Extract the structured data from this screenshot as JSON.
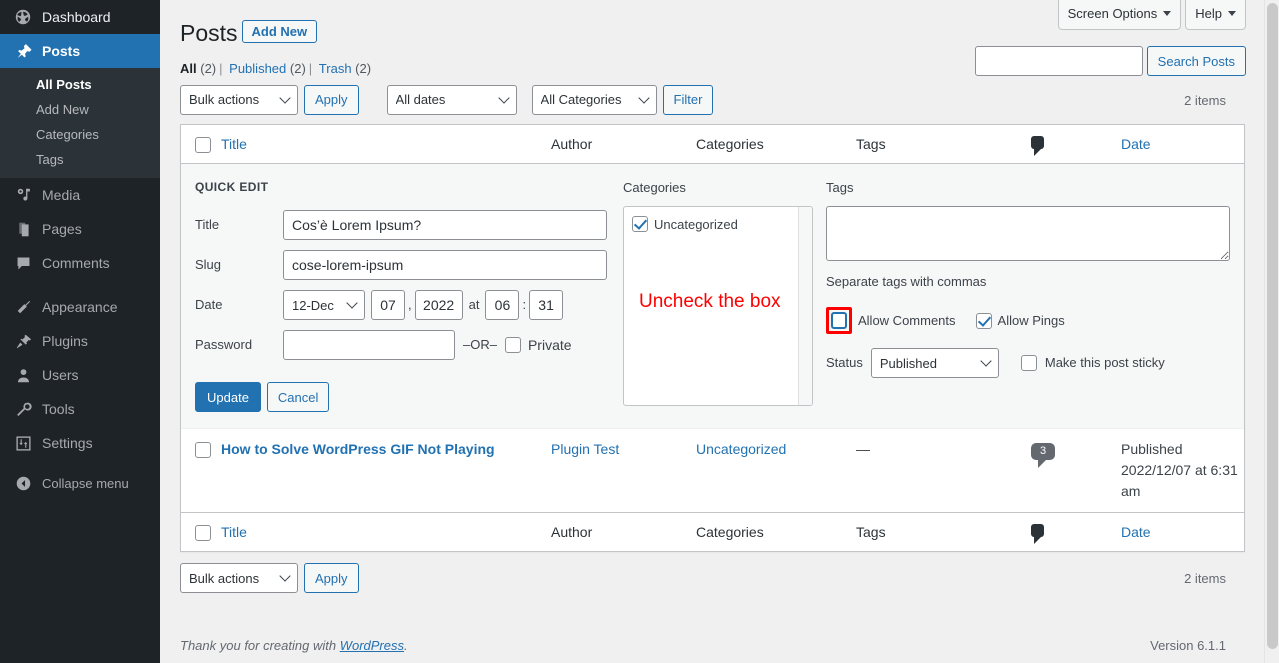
{
  "sidebar": {
    "items": [
      {
        "label": "Dashboard",
        "icon": "dashboard-icon",
        "current": false,
        "dim": false
      },
      {
        "label": "Posts",
        "icon": "pin-icon",
        "current": true,
        "dim": false
      },
      {
        "label": "Media",
        "icon": "media-icon",
        "current": false,
        "dim": true
      },
      {
        "label": "Pages",
        "icon": "pages-icon",
        "current": false,
        "dim": true
      },
      {
        "label": "Comments",
        "icon": "comment-icon",
        "current": false,
        "dim": true
      },
      {
        "label": "Appearance",
        "icon": "appearance-icon",
        "current": false,
        "dim": true
      },
      {
        "label": "Plugins",
        "icon": "plugins-icon",
        "current": false,
        "dim": true
      },
      {
        "label": "Users",
        "icon": "users-icon",
        "current": false,
        "dim": true
      },
      {
        "label": "Tools",
        "icon": "tools-icon",
        "current": false,
        "dim": true
      },
      {
        "label": "Settings",
        "icon": "settings-icon",
        "current": false,
        "dim": true
      }
    ],
    "submenu": [
      {
        "label": "All Posts",
        "current": true
      },
      {
        "label": "Add New",
        "current": false
      },
      {
        "label": "Categories",
        "current": false
      },
      {
        "label": "Tags",
        "current": false
      }
    ],
    "collapse_label": "Collapse menu",
    "collapse_icon": "collapse-arrow-icon",
    "accent_color": "#2271b1",
    "bg_color": "#1d2327"
  },
  "screen_meta": {
    "screen_options_label": "Screen Options",
    "help_label": "Help"
  },
  "header": {
    "title": "Posts",
    "add_new_label": "Add New"
  },
  "search": {
    "value": "",
    "placeholder": "",
    "button_label": "Search Posts"
  },
  "views": [
    {
      "label": "All",
      "count": "(2)",
      "current": true
    },
    {
      "label": "Published",
      "count": "(2)",
      "current": false
    },
    {
      "label": "Trash",
      "count": "(2)",
      "current": false
    }
  ],
  "tablenav_top": {
    "bulk_actions_value": "Bulk actions",
    "apply_label": "Apply",
    "all_dates_value": "All dates",
    "all_categories_value": "All Categories",
    "filter_label": "Filter",
    "displaying_num": "2 items"
  },
  "tablenav_bottom": {
    "bulk_actions_value": "Bulk actions",
    "apply_label": "Apply",
    "displaying_num": "2 items"
  },
  "table": {
    "columns": {
      "title": "Title",
      "author": "Author",
      "categories": "Categories",
      "tags": "Tags",
      "comments_icon": "comment-icon",
      "date": "Date"
    },
    "rows": [
      {
        "title": "How to Solve WordPress GIF Not Playing",
        "author": "Plugin Test",
        "categories": "Uncategorized",
        "tags": "—",
        "comments": "3",
        "date_status": "Published",
        "date_value": "2022/12/07 at 6:31 am"
      }
    ]
  },
  "quick_edit": {
    "heading": "QUICK EDIT",
    "title_label": "Title",
    "title_value": "Cos’è Lorem Ipsum?",
    "slug_label": "Slug",
    "slug_value": "cose-lorem-ipsum",
    "date_label": "Date",
    "month_value": "12-Dec",
    "day_value": "07",
    "comma": ",",
    "year_value": "2022",
    "at_label": "at",
    "hour_value": "06",
    "colon": ":",
    "minute_value": "31",
    "password_label": "Password",
    "password_value": "",
    "or_label": "–OR–",
    "private_label": "Private",
    "private_checked": false,
    "categories_label": "Categories",
    "category_items": [
      {
        "label": "Uncategorized",
        "checked": true
      }
    ],
    "tags_label": "Tags",
    "tags_value": "",
    "tags_hint": "Separate tags with commas",
    "allow_comments_label": "Allow Comments",
    "allow_comments_checked": false,
    "allow_pings_label": "Allow Pings",
    "allow_pings_checked": true,
    "status_label": "Status",
    "status_value": "Published",
    "sticky_label": "Make this post sticky",
    "sticky_checked": false,
    "update_label": "Update",
    "cancel_label": "Cancel"
  },
  "annotation": {
    "text": "Uncheck the box",
    "color": "#ff0000",
    "highlight_border_color": "#ff0000"
  },
  "footer": {
    "thanks_prefix": "Thank you for creating with ",
    "wordpress_link": "WordPress",
    "thanks_suffix": ".",
    "version": "Version 6.1.1"
  }
}
